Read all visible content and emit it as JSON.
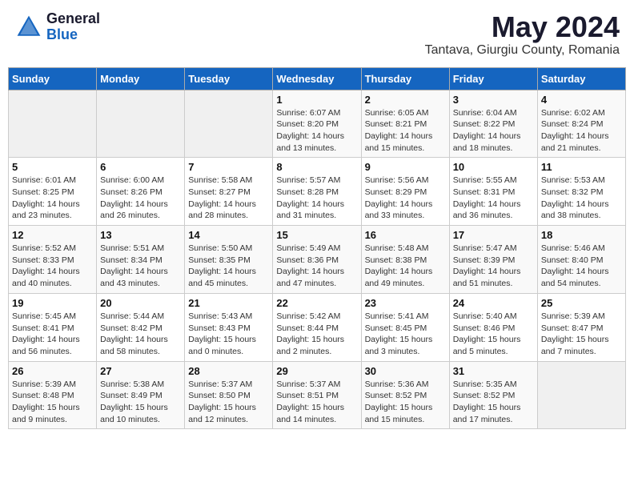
{
  "header": {
    "logo_general": "General",
    "logo_blue": "Blue",
    "month_year": "May 2024",
    "location": "Tantava, Giurgiu County, Romania"
  },
  "weekdays": [
    "Sunday",
    "Monday",
    "Tuesday",
    "Wednesday",
    "Thursday",
    "Friday",
    "Saturday"
  ],
  "weeks": [
    [
      {
        "day": "",
        "info": ""
      },
      {
        "day": "",
        "info": ""
      },
      {
        "day": "",
        "info": ""
      },
      {
        "day": "1",
        "info": "Sunrise: 6:07 AM\nSunset: 8:20 PM\nDaylight: 14 hours\nand 13 minutes."
      },
      {
        "day": "2",
        "info": "Sunrise: 6:05 AM\nSunset: 8:21 PM\nDaylight: 14 hours\nand 15 minutes."
      },
      {
        "day": "3",
        "info": "Sunrise: 6:04 AM\nSunset: 8:22 PM\nDaylight: 14 hours\nand 18 minutes."
      },
      {
        "day": "4",
        "info": "Sunrise: 6:02 AM\nSunset: 8:24 PM\nDaylight: 14 hours\nand 21 minutes."
      }
    ],
    [
      {
        "day": "5",
        "info": "Sunrise: 6:01 AM\nSunset: 8:25 PM\nDaylight: 14 hours\nand 23 minutes."
      },
      {
        "day": "6",
        "info": "Sunrise: 6:00 AM\nSunset: 8:26 PM\nDaylight: 14 hours\nand 26 minutes."
      },
      {
        "day": "7",
        "info": "Sunrise: 5:58 AM\nSunset: 8:27 PM\nDaylight: 14 hours\nand 28 minutes."
      },
      {
        "day": "8",
        "info": "Sunrise: 5:57 AM\nSunset: 8:28 PM\nDaylight: 14 hours\nand 31 minutes."
      },
      {
        "day": "9",
        "info": "Sunrise: 5:56 AM\nSunset: 8:29 PM\nDaylight: 14 hours\nand 33 minutes."
      },
      {
        "day": "10",
        "info": "Sunrise: 5:55 AM\nSunset: 8:31 PM\nDaylight: 14 hours\nand 36 minutes."
      },
      {
        "day": "11",
        "info": "Sunrise: 5:53 AM\nSunset: 8:32 PM\nDaylight: 14 hours\nand 38 minutes."
      }
    ],
    [
      {
        "day": "12",
        "info": "Sunrise: 5:52 AM\nSunset: 8:33 PM\nDaylight: 14 hours\nand 40 minutes."
      },
      {
        "day": "13",
        "info": "Sunrise: 5:51 AM\nSunset: 8:34 PM\nDaylight: 14 hours\nand 43 minutes."
      },
      {
        "day": "14",
        "info": "Sunrise: 5:50 AM\nSunset: 8:35 PM\nDaylight: 14 hours\nand 45 minutes."
      },
      {
        "day": "15",
        "info": "Sunrise: 5:49 AM\nSunset: 8:36 PM\nDaylight: 14 hours\nand 47 minutes."
      },
      {
        "day": "16",
        "info": "Sunrise: 5:48 AM\nSunset: 8:38 PM\nDaylight: 14 hours\nand 49 minutes."
      },
      {
        "day": "17",
        "info": "Sunrise: 5:47 AM\nSunset: 8:39 PM\nDaylight: 14 hours\nand 51 minutes."
      },
      {
        "day": "18",
        "info": "Sunrise: 5:46 AM\nSunset: 8:40 PM\nDaylight: 14 hours\nand 54 minutes."
      }
    ],
    [
      {
        "day": "19",
        "info": "Sunrise: 5:45 AM\nSunset: 8:41 PM\nDaylight: 14 hours\nand 56 minutes."
      },
      {
        "day": "20",
        "info": "Sunrise: 5:44 AM\nSunset: 8:42 PM\nDaylight: 14 hours\nand 58 minutes."
      },
      {
        "day": "21",
        "info": "Sunrise: 5:43 AM\nSunset: 8:43 PM\nDaylight: 15 hours\nand 0 minutes."
      },
      {
        "day": "22",
        "info": "Sunrise: 5:42 AM\nSunset: 8:44 PM\nDaylight: 15 hours\nand 2 minutes."
      },
      {
        "day": "23",
        "info": "Sunrise: 5:41 AM\nSunset: 8:45 PM\nDaylight: 15 hours\nand 3 minutes."
      },
      {
        "day": "24",
        "info": "Sunrise: 5:40 AM\nSunset: 8:46 PM\nDaylight: 15 hours\nand 5 minutes."
      },
      {
        "day": "25",
        "info": "Sunrise: 5:39 AM\nSunset: 8:47 PM\nDaylight: 15 hours\nand 7 minutes."
      }
    ],
    [
      {
        "day": "26",
        "info": "Sunrise: 5:39 AM\nSunset: 8:48 PM\nDaylight: 15 hours\nand 9 minutes."
      },
      {
        "day": "27",
        "info": "Sunrise: 5:38 AM\nSunset: 8:49 PM\nDaylight: 15 hours\nand 10 minutes."
      },
      {
        "day": "28",
        "info": "Sunrise: 5:37 AM\nSunset: 8:50 PM\nDaylight: 15 hours\nand 12 minutes."
      },
      {
        "day": "29",
        "info": "Sunrise: 5:37 AM\nSunset: 8:51 PM\nDaylight: 15 hours\nand 14 minutes."
      },
      {
        "day": "30",
        "info": "Sunrise: 5:36 AM\nSunset: 8:52 PM\nDaylight: 15 hours\nand 15 minutes."
      },
      {
        "day": "31",
        "info": "Sunrise: 5:35 AM\nSunset: 8:52 PM\nDaylight: 15 hours\nand 17 minutes."
      },
      {
        "day": "",
        "info": ""
      }
    ]
  ]
}
